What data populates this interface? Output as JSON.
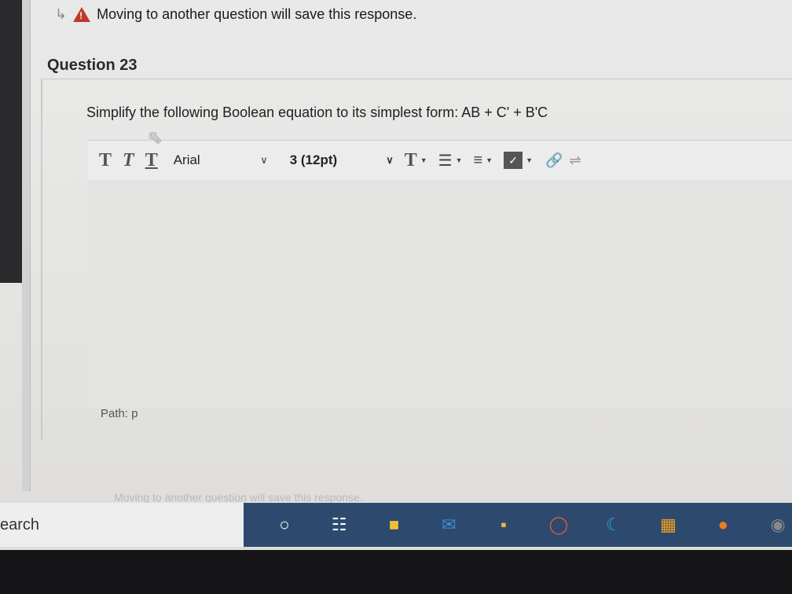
{
  "warning": {
    "text": "Moving to another question will save this response."
  },
  "question": {
    "title": "Question 23",
    "prompt": "Simplify the following Boolean equation to its simplest form: AB + C' + B'C"
  },
  "toolbar": {
    "bold": "T",
    "italic": "T",
    "underline": "T",
    "font_value": "Arial",
    "size_value": "3 (12pt)",
    "text_color": "T",
    "spell_label": "ABC"
  },
  "editor": {
    "value": "",
    "path_label": "Path: p"
  },
  "footer": {
    "warning_text": "Moving to another question will save this response."
  },
  "taskbar": {
    "search_text": "earch"
  },
  "colors": {
    "warning_red": "#c0392b",
    "taskbar": "#2d4a6e"
  }
}
